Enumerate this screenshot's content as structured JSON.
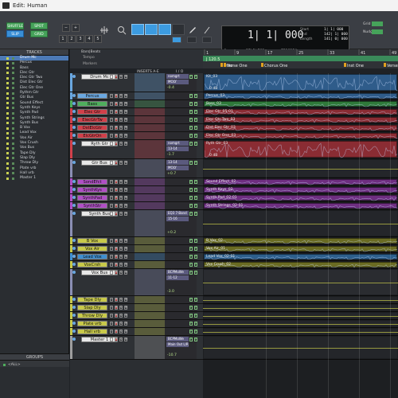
{
  "window": {
    "title": "Edit: Human"
  },
  "toolbar": {
    "modes": [
      "SHUFFLE",
      "SPOT",
      "SLIP",
      "GRID"
    ],
    "zoom_presets": [
      "1",
      "2",
      "3",
      "4",
      "5"
    ],
    "counter": {
      "main": "1| 1| 000",
      "label": "Cursor",
      "cursor_pos": "37| 2| 768",
      "cursor_val": "7318154"
    },
    "start_end": [
      {
        "label": "Start",
        "value": "1| 1| 000"
      },
      {
        "label": "End",
        "value": "142| 1| 000"
      },
      {
        "label": "Length",
        "value": "141| 0| 000"
      }
    ],
    "right": [
      {
        "label": "Grid",
        "value": "1 bar"
      },
      {
        "label": "Nudge",
        "value": "1 bar"
      }
    ]
  },
  "mixer": {
    "tracks_header": "TRACKS",
    "groups_header": "GROUPS",
    "groups_all": "<ALL>",
    "items": [
      "Drum Mc",
      "Percus",
      "Bass",
      "Elec Gtr",
      "Elec Gtr Two",
      "Dist Elec Gtr",
      "Elec Gtr One",
      "Rythm Gtr",
      "Gtr Bus",
      "Sound Effect",
      "Synth Keys",
      "Synth Pad",
      "Synth Strings",
      "Synth Bus",
      "B Vox",
      "Lead Vox",
      "Vox Air",
      "Vox Crush",
      "Vox Bus",
      "Tape Dly",
      "Slap Dly",
      "Throw Dly",
      "Plate vrb",
      "Hall vrb",
      "Master 1"
    ]
  },
  "edit_header": {
    "ruler_label": "Bars|Beats",
    "tempo": "Tempo",
    "markers": "Markers",
    "inserts": "INSERTS A-E",
    "io": "I / O"
  },
  "ruler": {
    "ticks": [
      "1",
      "9",
      "17",
      "25",
      "33",
      "41",
      "49",
      "57"
    ],
    "tempo_value": "J 120.5",
    "markers": [
      "Intro",
      "Verse One",
      "Chorus One",
      "Inst One",
      "Verse Two"
    ]
  },
  "tracks": [
    {
      "name": "Drum Mc",
      "color": "#6aa7e0",
      "h": 24,
      "vol": "-0.4",
      "io": "nomgrt",
      "io2": "MOLY",
      "clip": "Kit_03",
      "clip2": "0 dB",
      "clipColor": "#2f5c8a"
    },
    {
      "name": "Percus",
      "color": "#6aa7e0",
      "h": 10,
      "vol": "",
      "clip": "Percus_03",
      "clipColor": "#2f5c8a"
    },
    {
      "name": "Bass",
      "color": "#4fae5d",
      "h": 10,
      "vol": "",
      "clip": "Bass_03",
      "clipColor": "#2f7a3a"
    },
    {
      "name": "Elec Gtr",
      "color": "#d2404a",
      "h": 10,
      "vol": "",
      "clip": "Elec Gtr_05-01",
      "clipColor": "#8a2c33"
    },
    {
      "name": "ElecGtrTw",
      "color": "#d2404a",
      "h": 10,
      "vol": "",
      "clip": "Elec Gtr Two_03",
      "clipColor": "#8a2c33"
    },
    {
      "name": "DstElcGtr",
      "color": "#d2404a",
      "h": 10,
      "vol": "",
      "clip": "Dist Elec Gtr_03",
      "clipColor": "#8a2c33"
    },
    {
      "name": "ElcGtrOn",
      "color": "#d2404a",
      "h": 10,
      "vol": "",
      "clip": "Elec Gtr One_03",
      "clipColor": "#8a2c33"
    },
    {
      "name": "Ryth Gtr",
      "color": "#d2404a",
      "h": 24,
      "vol": "-1.7",
      "io": "nomgrt",
      "io2": "13-14",
      "clip": "Ryth Gtr_03",
      "clip2": "0 dB",
      "clipColor": "#8a2c33"
    },
    {
      "name": "Gtr Bus",
      "color": "#8b8fb4",
      "h": 24,
      "vol": "+0.7",
      "io": "13-14",
      "io2": "MOLY",
      "clip": "",
      "clipColor": "#24262a"
    },
    {
      "name": "SondEfct",
      "color": "#b04fc6",
      "h": 10,
      "vol": "",
      "clip": "Sound Effect_02",
      "clipColor": "#6e2e80"
    },
    {
      "name": "SynthKys",
      "color": "#b04fc6",
      "h": 10,
      "vol": "",
      "clip": "Synth Keys_02",
      "clipColor": "#6e2e80"
    },
    {
      "name": "SynthPad",
      "color": "#b04fc6",
      "h": 10,
      "vol": "",
      "clip": "Synth Pad_02-01",
      "clipColor": "#6e2e80"
    },
    {
      "name": "SynthStr",
      "color": "#b04fc6",
      "h": 10,
      "vol": "",
      "clip": "Synth Strings_02-01",
      "clipColor": "#6e2e80"
    },
    {
      "name": "Synth Bus",
      "color": "#8b8fb4",
      "h": 34,
      "vol": "+0.2",
      "io": "EQ3 7-Band",
      "io2": "15-16",
      "clip": "",
      "clipColor": "#24262a"
    },
    {
      "name": "B Vox",
      "color": "#c8c94a",
      "h": 10,
      "vol": "",
      "clip": "B Vox_02",
      "clipColor": "#6a6b22"
    },
    {
      "name": "Vox Air",
      "color": "#c8c94a",
      "h": 10,
      "vol": "",
      "clip": "Vox Air_01",
      "clipColor": "#6a6b22"
    },
    {
      "name": "Lead Vox",
      "color": "#3f8fd0",
      "h": 10,
      "vol": "",
      "clip": "Lead Vox_02-01",
      "clipColor": "#2d5f8c"
    },
    {
      "name": "VoxCrsh",
      "color": "#c8c94a",
      "h": 10,
      "vol": "",
      "clip": "Vox Crush_02",
      "clipColor": "#6a6b22"
    },
    {
      "name": "Vox Bus",
      "color": "#8b8fb4",
      "h": 34,
      "vol": "-3.0",
      "io": "BCPMoWe",
      "io2": "11-12",
      "clip": "",
      "clipColor": "#2a2c30"
    },
    {
      "name": "Tape Dly",
      "color": "#c8c94a",
      "h": 10,
      "vol": "",
      "clip": "",
      "clipColor": "#24262a"
    },
    {
      "name": "Slap Dly",
      "color": "#c8c94a",
      "h": 10,
      "vol": "",
      "clip": "",
      "clipColor": "#24262a"
    },
    {
      "name": "Throw Dly",
      "color": "#c8c94a",
      "h": 10,
      "vol": "",
      "clip": "",
      "clipColor": "#24262a"
    },
    {
      "name": "Plate vrb",
      "color": "#c8c94a",
      "h": 10,
      "vol": "",
      "clip": "",
      "clipColor": "#24262a"
    },
    {
      "name": "Hall vrb",
      "color": "#c8c94a",
      "h": 10,
      "vol": "",
      "clip": "",
      "clipColor": "#24262a"
    },
    {
      "name": "Master 1",
      "color": "#9e9e9e",
      "h": 30,
      "vol": "-10.7",
      "io": "BCPMoWe",
      "io2": "Main Out L/R",
      "clip": "",
      "clipColor": "#24262a"
    }
  ]
}
